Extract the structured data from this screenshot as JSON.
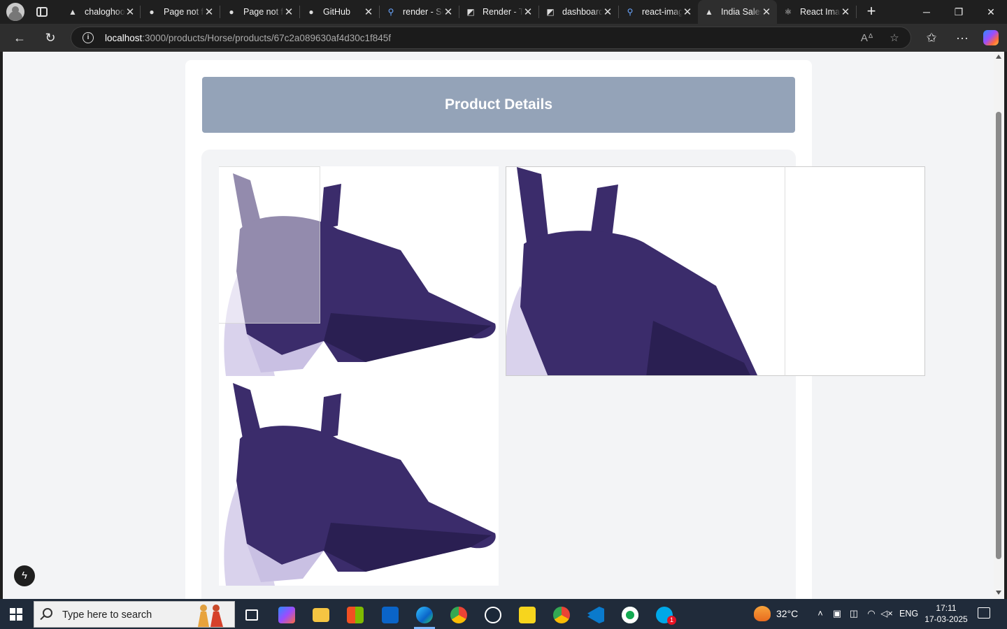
{
  "browser": {
    "tabs": [
      {
        "title": "chaloghoomne",
        "icon": "vercel-triangle-icon"
      },
      {
        "title": "Page not found",
        "icon": "github-icon"
      },
      {
        "title": "Page not found",
        "icon": "github-icon"
      },
      {
        "title": "GitHub",
        "icon": "github-icon"
      },
      {
        "title": "render - Search",
        "icon": "search-icon"
      },
      {
        "title": "Render - The",
        "icon": "render-icon"
      },
      {
        "title": "dashboard",
        "icon": "render-icon"
      },
      {
        "title": "react-image",
        "icon": "search-icon"
      },
      {
        "title": "India Sales",
        "icon": "vercel-triangle-icon",
        "active": true
      },
      {
        "title": "React Image",
        "icon": "react-icon"
      }
    ],
    "url_host": "localhost",
    "url_path": ":3000/products/Horse/products/67c2a089630af4d30c1f845f"
  },
  "page": {
    "heading": "Product Details",
    "images": [
      {
        "alt": "horse-fly-mask-image",
        "mask_color": "#3b2c6b"
      },
      {
        "alt": "horse-fly-mask-image",
        "mask_color": "#3b2c6b"
      }
    ]
  },
  "taskbar": {
    "search_placeholder": "Type here to search",
    "weather": "32°C",
    "language": "ENG",
    "time": "17:11",
    "date": "17-03-2025",
    "apps": [
      {
        "name": "task-view-icon"
      },
      {
        "name": "copilot-icon"
      },
      {
        "name": "file-explorer-icon"
      },
      {
        "name": "microsoft-store-icon"
      },
      {
        "name": "outlook-icon"
      },
      {
        "name": "edge-icon",
        "active": true
      },
      {
        "name": "chrome-icon"
      },
      {
        "name": "steam-icon"
      },
      {
        "name": "sticky-notes-icon"
      },
      {
        "name": "chrome-profile-icon"
      },
      {
        "name": "vscode-icon"
      },
      {
        "name": "mongodb-compass-icon"
      },
      {
        "name": "skype-icon",
        "badge": "1"
      }
    ],
    "weather_badge": "1"
  }
}
